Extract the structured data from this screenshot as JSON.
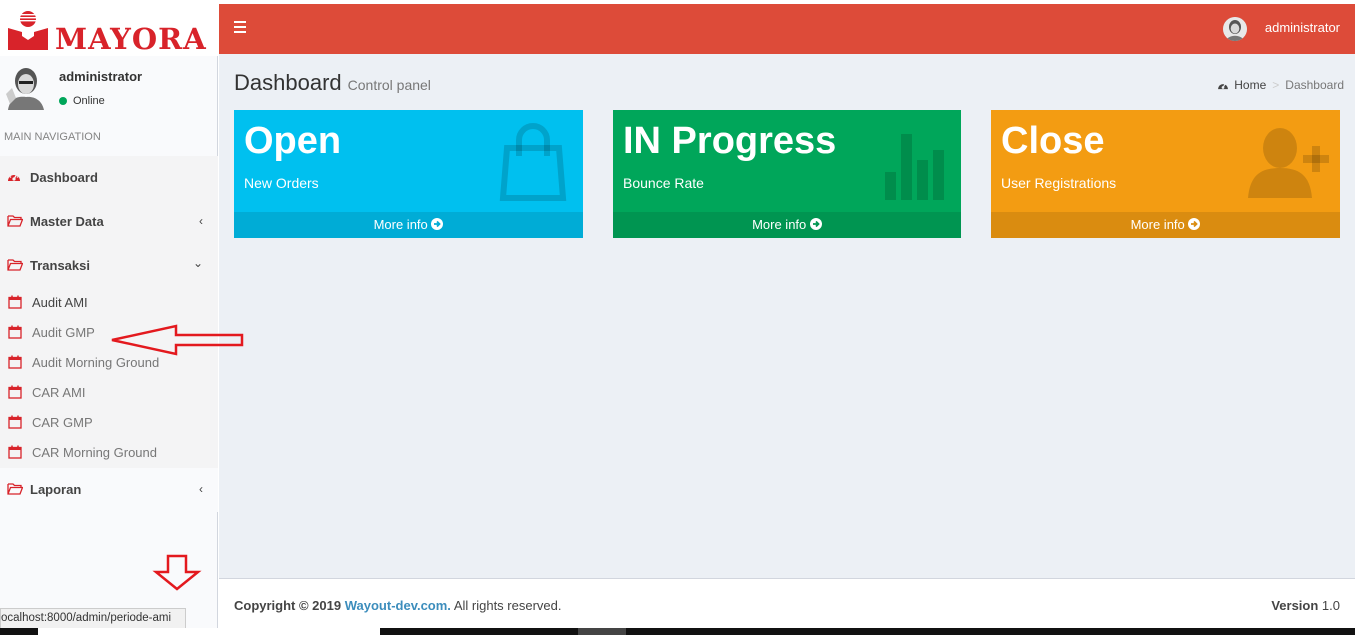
{
  "brand": {
    "name": "MAYORA",
    "color": "#d8232a"
  },
  "sidebar": {
    "user": {
      "name": "administrator",
      "status": "Online"
    },
    "nav_header": "MAIN NAVIGATION",
    "items": [
      {
        "label": "Dashboard",
        "icon": "dashboard-icon"
      },
      {
        "label": "Master Data",
        "icon": "folder-icon",
        "chevron": "‹"
      },
      {
        "label": "Transaksi",
        "icon": "folder-open-icon",
        "chevron": "⌄"
      },
      {
        "label": "Laporan",
        "icon": "folder-icon",
        "chevron": "‹"
      }
    ],
    "subitems": [
      {
        "label": "Audit AMI"
      },
      {
        "label": "Audit GMP"
      },
      {
        "label": "Audit Morning Ground"
      },
      {
        "label": "CAR AMI"
      },
      {
        "label": "CAR GMP"
      },
      {
        "label": "CAR Morning Ground"
      }
    ]
  },
  "header": {
    "user": "administrator",
    "color": "#dd4b39"
  },
  "page": {
    "title": "Dashboard",
    "subtitle": "Control panel",
    "breadcrumb": {
      "home": "Home",
      "current": "Dashboard"
    }
  },
  "boxes": [
    {
      "title": "Open",
      "desc": "New Orders",
      "more": "More info",
      "color": "#00c0ef",
      "footer_color": "#00acd6",
      "icon": "shopping-bag-icon"
    },
    {
      "title": "IN Progress",
      "desc": "Bounce Rate",
      "more": "More info",
      "color": "#00a65a",
      "footer_color": "#009551",
      "icon": "bar-chart-icon"
    },
    {
      "title": "Close",
      "desc": "User Registrations",
      "more": "More info",
      "color": "#f39c12",
      "footer_color": "#da8c10",
      "icon": "user-plus-icon"
    }
  ],
  "footer": {
    "copyright_prefix": "Copyright © 2019",
    "company": "Wayout-dev.com.",
    "rights": "All rights reserved.",
    "version_label": "Version",
    "version": "1.0"
  },
  "statusbar": {
    "url": "ocalhost:8000/admin/periode-ami"
  }
}
